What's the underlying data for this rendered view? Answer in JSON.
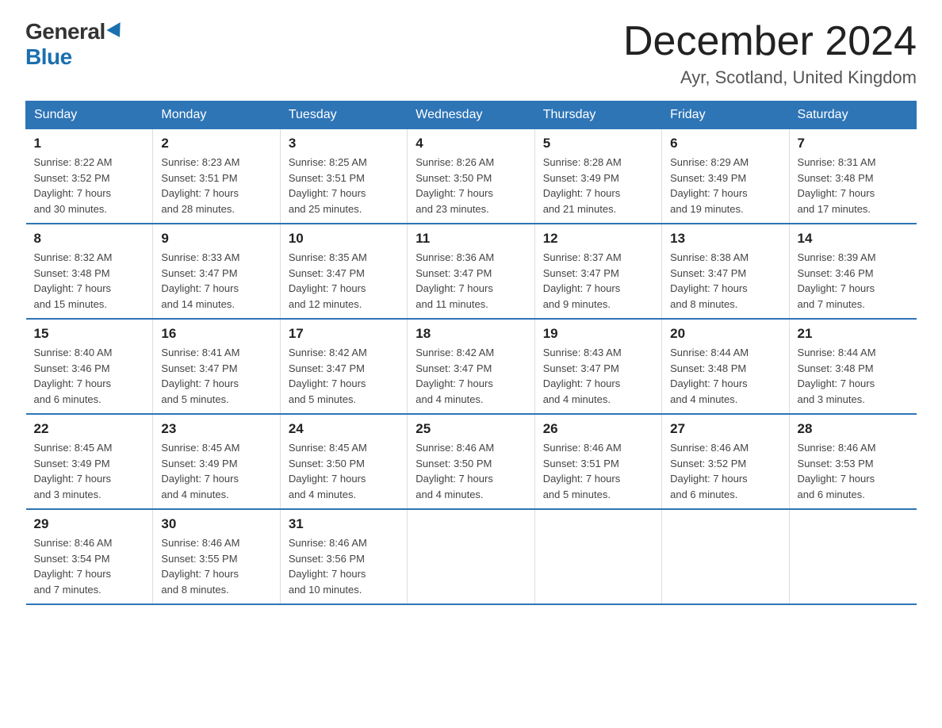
{
  "logo": {
    "general": "General",
    "blue": "Blue"
  },
  "title": "December 2024",
  "subtitle": "Ayr, Scotland, United Kingdom",
  "weekdays": [
    "Sunday",
    "Monday",
    "Tuesday",
    "Wednesday",
    "Thursday",
    "Friday",
    "Saturday"
  ],
  "weeks": [
    [
      {
        "day": "1",
        "sunrise": "8:22 AM",
        "sunset": "3:52 PM",
        "daylight": "7 hours and 30 minutes."
      },
      {
        "day": "2",
        "sunrise": "8:23 AM",
        "sunset": "3:51 PM",
        "daylight": "7 hours and 28 minutes."
      },
      {
        "day": "3",
        "sunrise": "8:25 AM",
        "sunset": "3:51 PM",
        "daylight": "7 hours and 25 minutes."
      },
      {
        "day": "4",
        "sunrise": "8:26 AM",
        "sunset": "3:50 PM",
        "daylight": "7 hours and 23 minutes."
      },
      {
        "day": "5",
        "sunrise": "8:28 AM",
        "sunset": "3:49 PM",
        "daylight": "7 hours and 21 minutes."
      },
      {
        "day": "6",
        "sunrise": "8:29 AM",
        "sunset": "3:49 PM",
        "daylight": "7 hours and 19 minutes."
      },
      {
        "day": "7",
        "sunrise": "8:31 AM",
        "sunset": "3:48 PM",
        "daylight": "7 hours and 17 minutes."
      }
    ],
    [
      {
        "day": "8",
        "sunrise": "8:32 AM",
        "sunset": "3:48 PM",
        "daylight": "7 hours and 15 minutes."
      },
      {
        "day": "9",
        "sunrise": "8:33 AM",
        "sunset": "3:47 PM",
        "daylight": "7 hours and 14 minutes."
      },
      {
        "day": "10",
        "sunrise": "8:35 AM",
        "sunset": "3:47 PM",
        "daylight": "7 hours and 12 minutes."
      },
      {
        "day": "11",
        "sunrise": "8:36 AM",
        "sunset": "3:47 PM",
        "daylight": "7 hours and 11 minutes."
      },
      {
        "day": "12",
        "sunrise": "8:37 AM",
        "sunset": "3:47 PM",
        "daylight": "7 hours and 9 minutes."
      },
      {
        "day": "13",
        "sunrise": "8:38 AM",
        "sunset": "3:47 PM",
        "daylight": "7 hours and 8 minutes."
      },
      {
        "day": "14",
        "sunrise": "8:39 AM",
        "sunset": "3:46 PM",
        "daylight": "7 hours and 7 minutes."
      }
    ],
    [
      {
        "day": "15",
        "sunrise": "8:40 AM",
        "sunset": "3:46 PM",
        "daylight": "7 hours and 6 minutes."
      },
      {
        "day": "16",
        "sunrise": "8:41 AM",
        "sunset": "3:47 PM",
        "daylight": "7 hours and 5 minutes."
      },
      {
        "day": "17",
        "sunrise": "8:42 AM",
        "sunset": "3:47 PM",
        "daylight": "7 hours and 5 minutes."
      },
      {
        "day": "18",
        "sunrise": "8:42 AM",
        "sunset": "3:47 PM",
        "daylight": "7 hours and 4 minutes."
      },
      {
        "day": "19",
        "sunrise": "8:43 AM",
        "sunset": "3:47 PM",
        "daylight": "7 hours and 4 minutes."
      },
      {
        "day": "20",
        "sunrise": "8:44 AM",
        "sunset": "3:48 PM",
        "daylight": "7 hours and 4 minutes."
      },
      {
        "day": "21",
        "sunrise": "8:44 AM",
        "sunset": "3:48 PM",
        "daylight": "7 hours and 3 minutes."
      }
    ],
    [
      {
        "day": "22",
        "sunrise": "8:45 AM",
        "sunset": "3:49 PM",
        "daylight": "7 hours and 3 minutes."
      },
      {
        "day": "23",
        "sunrise": "8:45 AM",
        "sunset": "3:49 PM",
        "daylight": "7 hours and 4 minutes."
      },
      {
        "day": "24",
        "sunrise": "8:45 AM",
        "sunset": "3:50 PM",
        "daylight": "7 hours and 4 minutes."
      },
      {
        "day": "25",
        "sunrise": "8:46 AM",
        "sunset": "3:50 PM",
        "daylight": "7 hours and 4 minutes."
      },
      {
        "day": "26",
        "sunrise": "8:46 AM",
        "sunset": "3:51 PM",
        "daylight": "7 hours and 5 minutes."
      },
      {
        "day": "27",
        "sunrise": "8:46 AM",
        "sunset": "3:52 PM",
        "daylight": "7 hours and 6 minutes."
      },
      {
        "day": "28",
        "sunrise": "8:46 AM",
        "sunset": "3:53 PM",
        "daylight": "7 hours and 6 minutes."
      }
    ],
    [
      {
        "day": "29",
        "sunrise": "8:46 AM",
        "sunset": "3:54 PM",
        "daylight": "7 hours and 7 minutes."
      },
      {
        "day": "30",
        "sunrise": "8:46 AM",
        "sunset": "3:55 PM",
        "daylight": "7 hours and 8 minutes."
      },
      {
        "day": "31",
        "sunrise": "8:46 AM",
        "sunset": "3:56 PM",
        "daylight": "7 hours and 10 minutes."
      },
      null,
      null,
      null,
      null
    ]
  ],
  "labels": {
    "sunrise": "Sunrise:",
    "sunset": "Sunset:",
    "daylight": "Daylight:"
  }
}
